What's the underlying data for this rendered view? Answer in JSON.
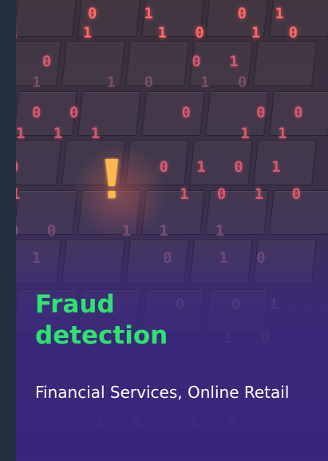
{
  "card": {
    "title": "Fraud detection",
    "subtitle": "Financial Services, Online Retail",
    "image_icon": "exclamation-alert-icon",
    "colors": {
      "title": "#2ee26f",
      "subtitle": "#ffffff",
      "background": "#232f3e",
      "overlay": "#3a287a",
      "alert": "#ffb84d"
    }
  }
}
